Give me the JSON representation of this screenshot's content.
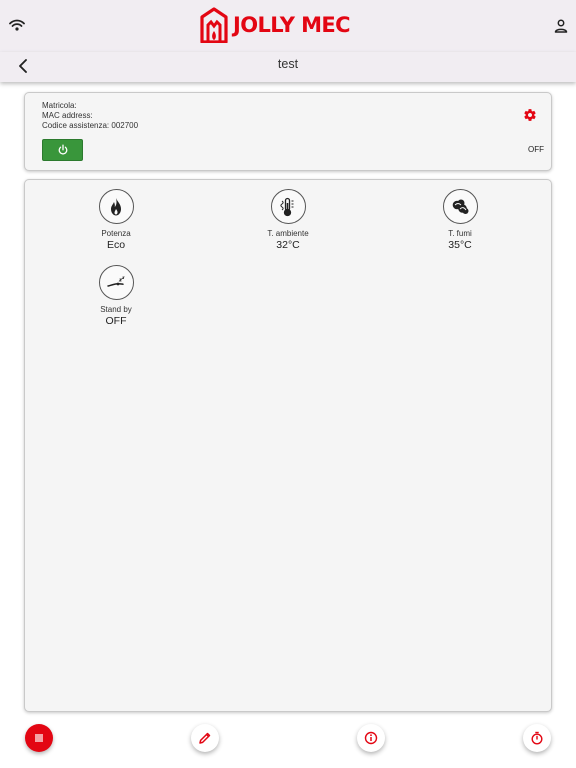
{
  "app": {
    "brand_name": "JOLLY MEC",
    "brand_color": "#e30613",
    "page_title": "test"
  },
  "status_bar": {
    "wifi_icon": "wifi-icon",
    "user_icon": "user-icon"
  },
  "device": {
    "matricola_label": "Matricola:",
    "mac_label": "MAC address:",
    "codice_line": "Codice assistenza: 002700",
    "state": "OFF",
    "power_color": "#39963b"
  },
  "tiles": [
    {
      "label": "Potenza",
      "value": "Eco",
      "icon": "flame-icon"
    },
    {
      "label": "T. ambiente",
      "value": "32°C",
      "icon": "thermometer-icon"
    },
    {
      "label": "T. fumi",
      "value": "35°C",
      "icon": "smoke-icon"
    },
    {
      "label": "Stand by",
      "value": "OFF",
      "icon": "standby-icon"
    }
  ],
  "bottom_actions": [
    {
      "icon": "menu-icon"
    },
    {
      "icon": "edit-icon"
    },
    {
      "icon": "info-icon"
    },
    {
      "icon": "timer-icon"
    }
  ]
}
